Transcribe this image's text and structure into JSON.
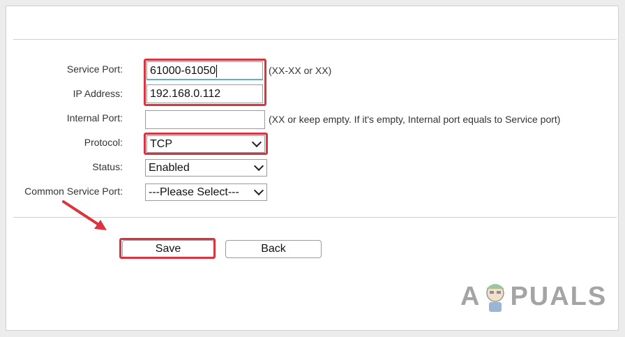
{
  "form": {
    "service_port": {
      "label": "Service Port:",
      "value": "61000-61050",
      "hint": "(XX-XX or XX)"
    },
    "ip_address": {
      "label": "IP Address:",
      "value": "192.168.0.112"
    },
    "internal_port": {
      "label": "Internal Port:",
      "value": "",
      "hint": "(XX or keep empty. If it's empty, Internal port equals to Service port)"
    },
    "protocol": {
      "label": "Protocol:",
      "value": "TCP"
    },
    "status": {
      "label": "Status:",
      "value": "Enabled"
    },
    "common_service_port": {
      "label": "Common Service Port:",
      "value": "---Please Select---"
    }
  },
  "buttons": {
    "save": "Save",
    "back": "Back"
  },
  "watermark": {
    "text": "APPUALS"
  },
  "colors": {
    "highlight": "#d9343f",
    "focus": "#59b5c9"
  }
}
